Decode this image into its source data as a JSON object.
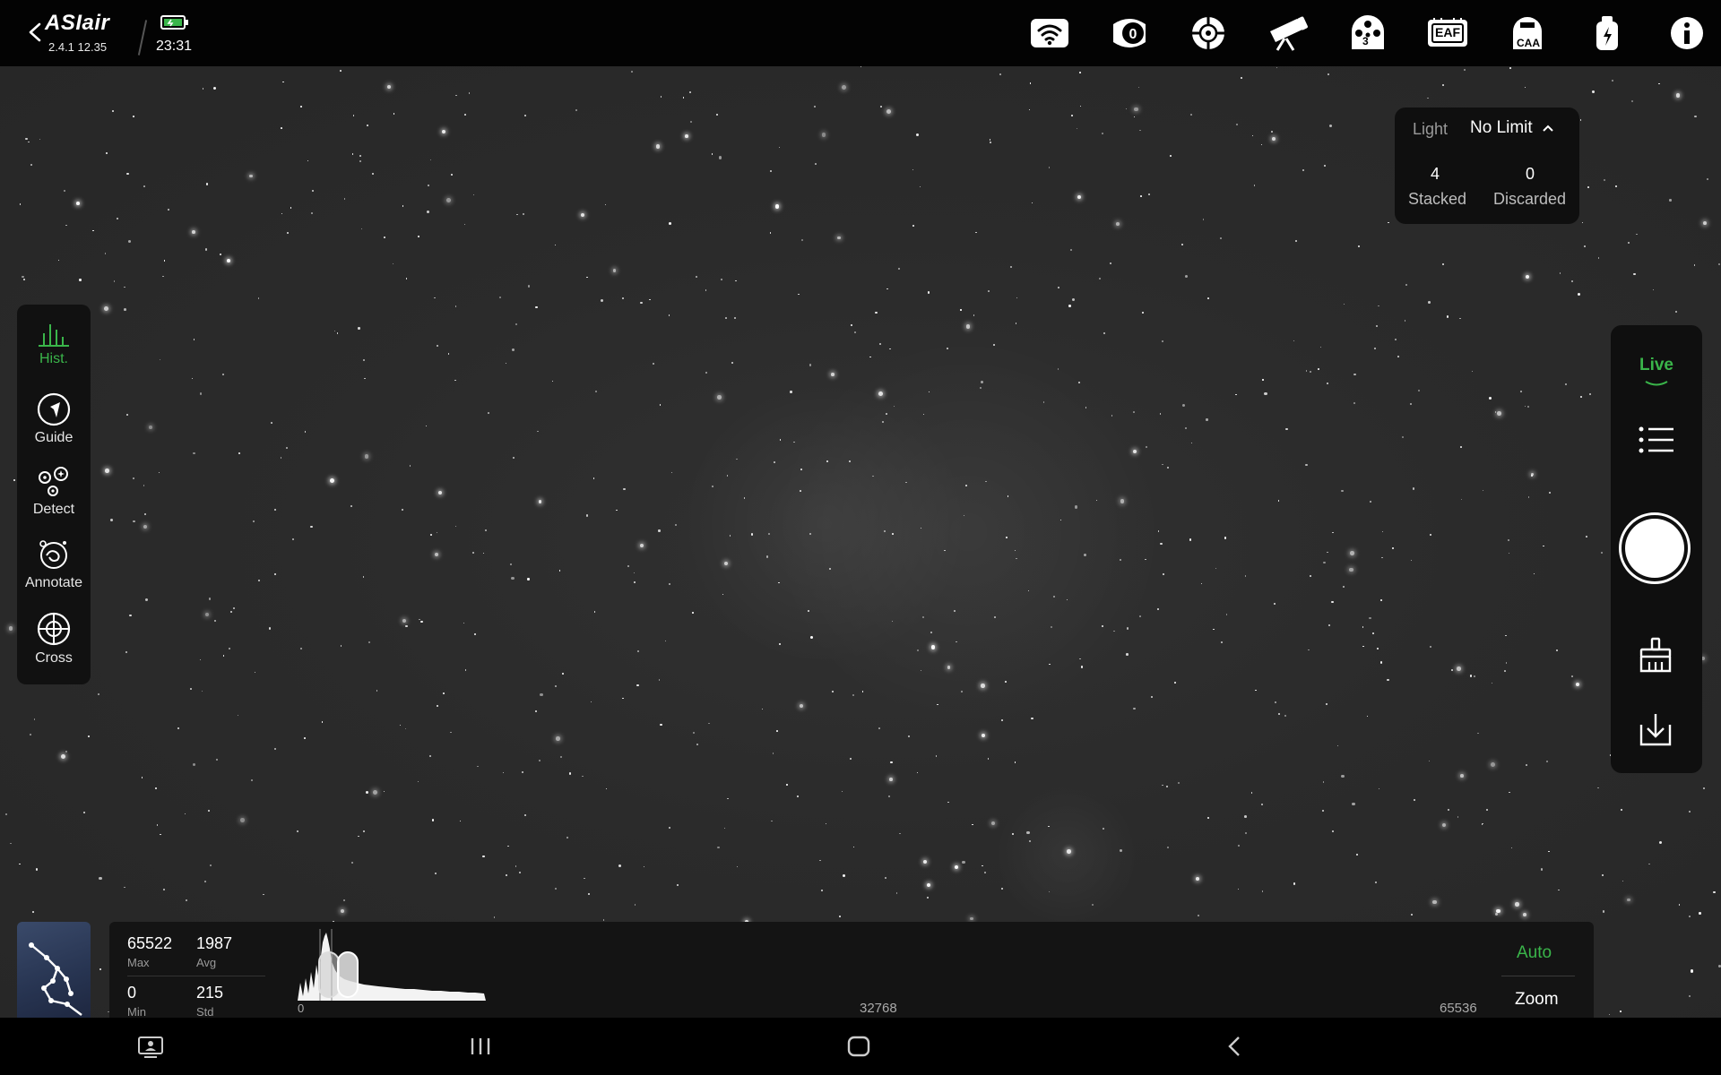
{
  "app": {
    "brand": "ASIair",
    "version": "2.4.1 12.35",
    "time": "23:31"
  },
  "topbar": {
    "icons": [
      "wifi-icon",
      "camera-zero-icon",
      "guide-scope-icon",
      "telescope-icon",
      "filter-wheel-icon",
      "eaf-icon",
      "caa-icon",
      "power-icon",
      "info-icon"
    ],
    "filter_wheel_position": "3",
    "eaf_label": "EAF",
    "caa_label": "CAA"
  },
  "left_panel": {
    "items": [
      {
        "label": "Hist.",
        "icon": "histogram-icon",
        "active": true
      },
      {
        "label": "Guide",
        "icon": "guide-icon",
        "active": false
      },
      {
        "label": "Detect",
        "icon": "detect-icon",
        "active": false
      },
      {
        "label": "Annotate",
        "icon": "annotate-icon",
        "active": false
      },
      {
        "label": "Cross",
        "icon": "crosshair-icon",
        "active": false
      }
    ],
    "active_color": "#3ab54a"
  },
  "stack": {
    "frame_type": "Light",
    "limit": "No Limit",
    "stacked_count": "4",
    "stacked_label": "Stacked",
    "discarded_count": "0",
    "discarded_label": "Discarded"
  },
  "right_panel": {
    "mode": "Live",
    "items": [
      "list-icon",
      "shutter-button",
      "clear-brush-icon",
      "download-icon"
    ]
  },
  "histogram": {
    "max": "65522",
    "max_label": "Max",
    "avg": "1987",
    "avg_label": "Avg",
    "min": "0",
    "min_label": "Min",
    "std": "215",
    "std_label": "Std",
    "axis_start": "0",
    "axis_mid": "32768",
    "axis_end": "65536",
    "auto_label": "Auto",
    "zoom_label": "Zoom"
  },
  "bottom_nav": {
    "icons": [
      "screen-capture-icon",
      "recent-apps-icon",
      "home-icon",
      "back-icon"
    ]
  },
  "colors": {
    "accent": "#3ab54a",
    "panel": "#111111",
    "sky": "#2b2b2b"
  }
}
